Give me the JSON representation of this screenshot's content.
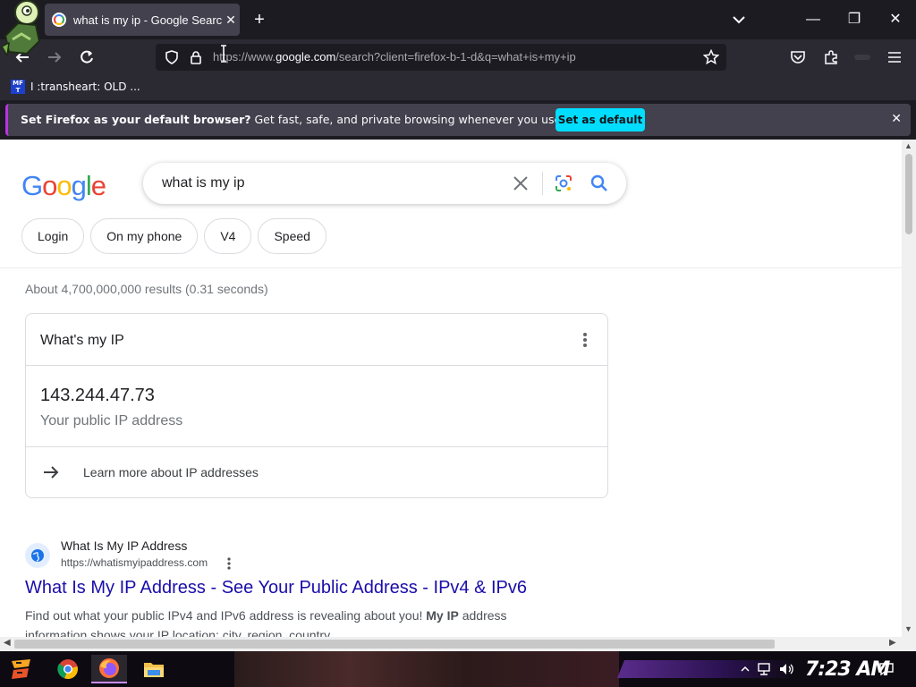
{
  "browser": {
    "tab_title": "what is my ip - Google Search",
    "tab_close": "✕",
    "new_tab": "+",
    "minimize": "—",
    "maximize": "❐",
    "close": "✕",
    "url_prefix": "https://www.",
    "url_host": "google.com",
    "url_path": "/search?client=firefox-b-1-d&q=what+is+my+ip",
    "bookmark_icon_text": "MF T",
    "bookmark_label": "I :transheart: OLD ...",
    "notification_bold": "Set Firefox as your default browser?",
    "notification_text": " Get fast, safe, and private browsing whenever you use the web.",
    "notification_button": "Set as default",
    "notification_close": "✕"
  },
  "google": {
    "logo": [
      "G",
      "o",
      "o",
      "g",
      "l",
      "e"
    ],
    "logo_colors": [
      "#4285f4",
      "#ea4335",
      "#fbbc05",
      "#4285f4",
      "#34a853",
      "#ea4335"
    ],
    "query": "what is my ip",
    "chips": [
      "Login",
      "On my phone",
      "V4",
      "Speed"
    ],
    "result_stats": "About 4,700,000,000 results (0.31 seconds)"
  },
  "ip_card": {
    "title": "What's my IP",
    "ip": "143.244.47.73",
    "caption": "Your public IP address",
    "learn_more": "Learn more about IP addresses"
  },
  "result": {
    "site": "What Is My IP Address",
    "url": "https://whatismyipaddress.com",
    "title": "What Is My IP Address - See Your Public Address - IPv4 & IPv6",
    "snippet_part1": "Find out what your public IPv4 and IPv6 address is revealing about you! ",
    "snippet_bold": "My IP",
    "snippet_part2": " address information shows your IP location; city, region, country, ..."
  },
  "taskbar": {
    "clock": "7:23 AM",
    "apps": [
      "start-icon",
      "chrome-icon",
      "firefox-icon",
      "file-explorer-icon"
    ]
  },
  "colors": {
    "link": "#1a0dab",
    "accent_cyan": "#00ddff",
    "firefox_dark": "#1c1b22"
  }
}
